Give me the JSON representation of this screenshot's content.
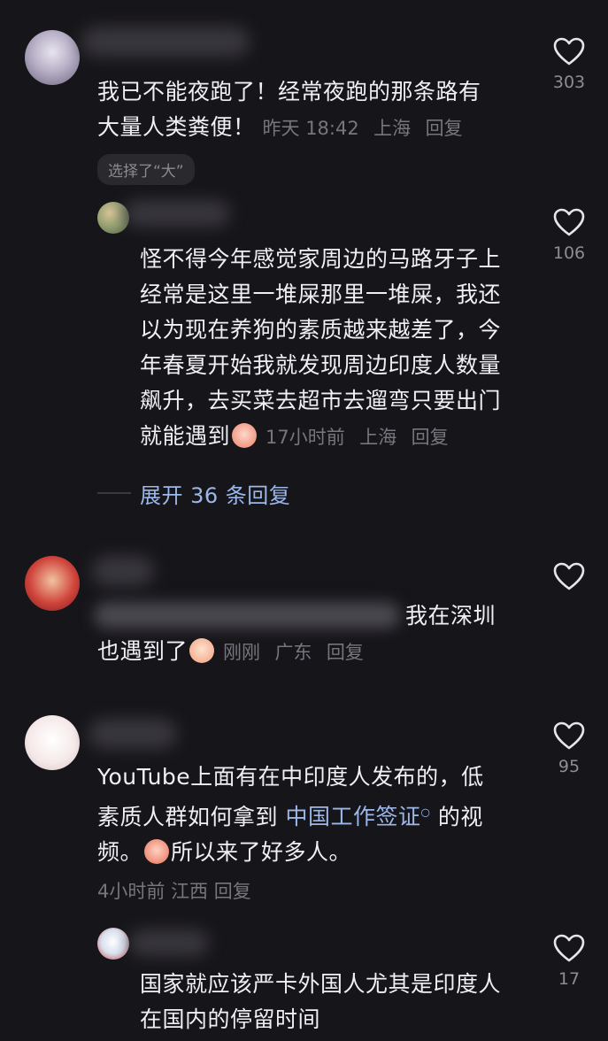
{
  "comments": [
    {
      "text_lines": [
        "我已不能夜跑了！经常夜跑的那条路有",
        "大量人类粪便！"
      ],
      "time": "昨天 18:42",
      "location": "上海",
      "reply_label": "回复",
      "chip": "选择了“大”",
      "likes": "303",
      "replies": [
        {
          "text_lines": [
            "怪不得今年感觉家周边的马路牙子上",
            "经常是这里一堆屎那里一堆屎，我还",
            "以为现在养狗的素质越来越差了，今",
            "年春夏开始我就发现周边印度人数量",
            "飙升，去买菜去超市去遛弯只要出门",
            "就能遇到"
          ],
          "time": "17小时前",
          "location": "上海",
          "reply_label": "回复",
          "likes": "106"
        }
      ],
      "expand_label": "展开 36 条回复"
    },
    {
      "text_tail": "我在深圳",
      "text_line2": "也遇到了",
      "time": "刚刚",
      "location": "广东",
      "reply_label": "回复",
      "likes": ""
    },
    {
      "text_line1": "YouTube上面有在中印度人发布的，低",
      "text_line2_a": "素质人群如何拿到 ",
      "text_line2_link": "中国工作签证",
      "text_line2_b": " 的视",
      "text_line3_a": "频。",
      "text_line3_b": "所以来了好多人。",
      "time": "4小时前",
      "location": "江西",
      "reply_label": "回复",
      "likes": "95",
      "replies": [
        {
          "text_lines": [
            "国家就应该严卡外国人尤其是印度人",
            "在国内的停留时间"
          ],
          "likes": "17"
        }
      ]
    }
  ],
  "icons": {
    "like": "heart-outline-icon",
    "search_hint": "search-hint-icon"
  },
  "colors": {
    "background": "#161519",
    "text": "#f0eff3",
    "meta": "#77757d",
    "link": "#9cb8ea"
  }
}
